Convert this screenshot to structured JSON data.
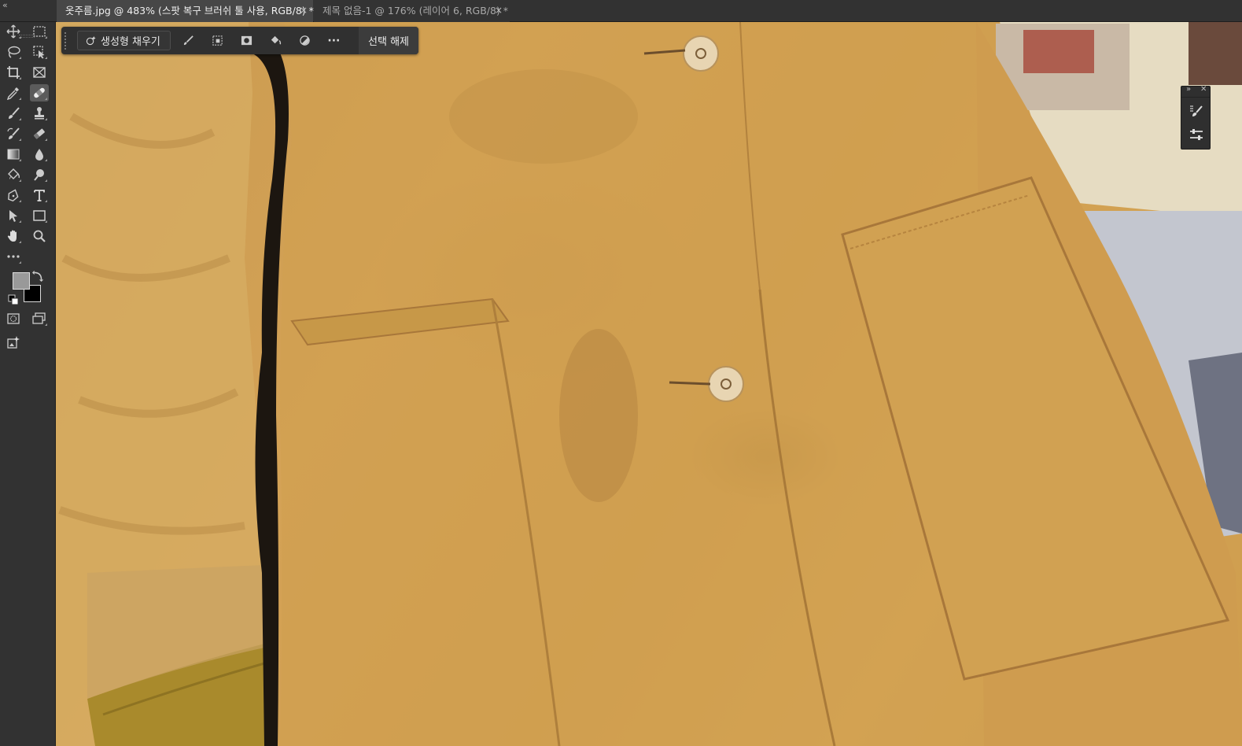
{
  "tabs": [
    {
      "label": "옷주름.jpg @ 483% (스팟 복구 브러쉬 툴 사용, RGB/8) *",
      "active": true
    },
    {
      "label": "제목 없음-1 @ 176% (레이어 6, RGB/8) *",
      "active": false
    }
  ],
  "tab_close_glyph": "×",
  "collapse_glyph": "«",
  "tools": [
    {
      "name": "move-tool",
      "icon": "move-icon"
    },
    {
      "name": "marquee-tool",
      "icon": "rect-marquee-icon"
    },
    {
      "name": "lasso-tool",
      "icon": "lasso-icon"
    },
    {
      "name": "object-select-tool",
      "icon": "object-select-icon"
    },
    {
      "name": "crop-tool",
      "icon": "crop-icon"
    },
    {
      "name": "frame-tool",
      "icon": "frame-icon"
    },
    {
      "name": "eyedropper-tool",
      "icon": "eyedropper-icon"
    },
    {
      "name": "spot-healing-brush-tool",
      "icon": "bandage-icon",
      "selected": true
    },
    {
      "name": "brush-tool",
      "icon": "brush-icon"
    },
    {
      "name": "clone-stamp-tool",
      "icon": "stamp-icon"
    },
    {
      "name": "history-brush-tool",
      "icon": "history-brush-icon"
    },
    {
      "name": "eraser-tool",
      "icon": "eraser-icon"
    },
    {
      "name": "gradient-tool",
      "icon": "gradient-icon"
    },
    {
      "name": "blur-tool",
      "icon": "drop-icon"
    },
    {
      "name": "paint-bucket-tool",
      "icon": "bucket-icon"
    },
    {
      "name": "dodge-tool",
      "icon": "dodge-icon"
    },
    {
      "name": "pen-tool",
      "icon": "pen-icon"
    },
    {
      "name": "type-tool",
      "icon": "type-icon"
    },
    {
      "name": "path-select-tool",
      "icon": "arrow-icon"
    },
    {
      "name": "shape-tool",
      "icon": "rectangle-icon"
    },
    {
      "name": "hand-tool",
      "icon": "hand-icon"
    },
    {
      "name": "zoom-tool",
      "icon": "magnifier-icon"
    },
    {
      "name": "more-tools",
      "icon": "ellipsis-icon"
    }
  ],
  "colors": {
    "foreground": "#999999",
    "background": "#000000",
    "accent_selected": "#5b5b5b"
  },
  "taskbar": {
    "generative_fill_label": "생성형 채우기",
    "deselect_label": "선택 해제",
    "more_glyph": "···",
    "icons": [
      "modify-selection-icon",
      "transform-selection-icon",
      "mask-icon",
      "fill-icon",
      "invert-icon",
      "more-icon"
    ]
  },
  "mini_panel": {
    "expand_glyph": "»",
    "close_glyph": "✕",
    "icons": [
      "brush-settings-icon",
      "adjustments-icon"
    ]
  }
}
